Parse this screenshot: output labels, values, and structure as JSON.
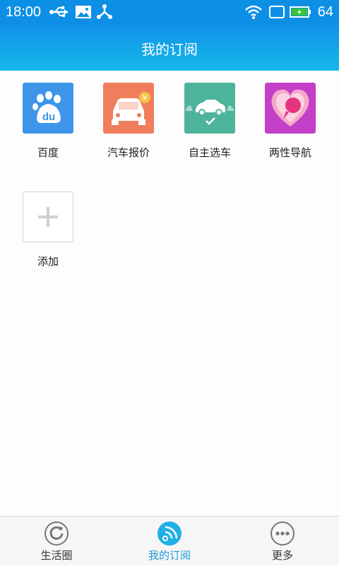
{
  "status_bar": {
    "time": "18:00",
    "battery_level": "64",
    "icons": [
      "usb-icon",
      "image-icon",
      "share-icon",
      "wifi-icon",
      "screen-icon",
      "battery-icon"
    ]
  },
  "header": {
    "title": "我的订阅"
  },
  "subscriptions": [
    {
      "label": "百度",
      "icon": "baidu-paw-icon",
      "color": "#3d95ea"
    },
    {
      "label": "汽车报价",
      "icon": "car-price-icon",
      "color": "#f07d5b"
    },
    {
      "label": "自主选车",
      "icon": "car-select-icon",
      "color": "#4db39a"
    },
    {
      "label": "两性导航",
      "icon": "heart-bubble-icon",
      "color": "#c43fc8"
    }
  ],
  "add": {
    "label": "添加",
    "icon": "plus-icon"
  },
  "bottom_nav": [
    {
      "label": "生活圈",
      "icon": "life-circle-icon",
      "active": false
    },
    {
      "label": "我的订阅",
      "icon": "rss-icon",
      "active": true,
      "accent": "#1f9ad8"
    },
    {
      "label": "更多",
      "icon": "more-dots-icon",
      "active": false
    }
  ]
}
